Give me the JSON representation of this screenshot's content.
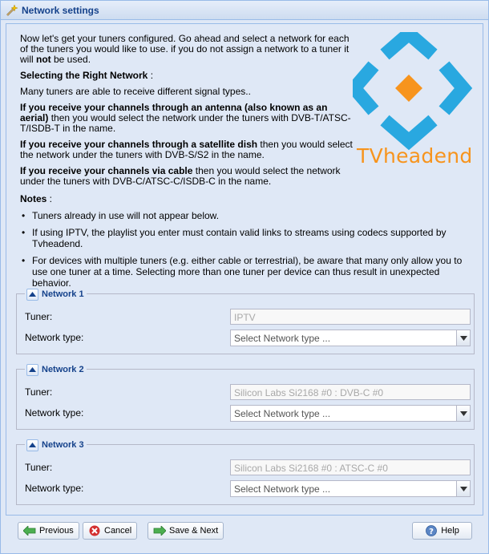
{
  "window": {
    "title": "Network settings"
  },
  "intro": {
    "p1_a": "Now let's get your tuners configured. Go ahead and select a network for each of the tuners you would like to use. if you do not assign a network to a tuner it will ",
    "p1_bold": "not",
    "p1_b": " be used.",
    "heading": "Selecting the Right Network",
    "heading_suffix": " :",
    "p2": "Many tuners are able to receive different signal types..",
    "antenna_bold": "If you receive your channels through an antenna (also known as an aerial)",
    "antenna_rest": " then you would select the network under the tuners with DVB-T/ATSC-T/ISDB-T in the name.",
    "satellite_bold": "If you receive your channels through a satellite dish",
    "satellite_rest": " then you would select the network under the tuners with DVB-S/S2 in the name.",
    "cable_bold": "If you receive your channels via cable",
    "cable_rest": " then you would select the network under the tuners with DVB-C/ATSC-C/ISDB-C in the name."
  },
  "logo": {
    "text": "TVheadend"
  },
  "notes": {
    "heading": "Notes",
    "heading_suffix": " :",
    "items": [
      "Tuners already in use will not appear below.",
      "If using IPTV, the playlist you enter must contain valid links to streams using codecs supported by Tvheadend.",
      "For devices with multiple tuners (e.g. either cable or terrestrial), be aware that many only allow you to use one tuner at a time. Selecting more than one tuner per device can thus result in unexpected behavior."
    ]
  },
  "networks": [
    {
      "legend": "Network 1",
      "tuner_label": "Tuner:",
      "tuner_value": "IPTV",
      "type_label": "Network type:",
      "type_placeholder": "Select Network type ..."
    },
    {
      "legend": "Network 2",
      "tuner_label": "Tuner:",
      "tuner_value": "Silicon Labs Si2168 #0 : DVB-C #0",
      "type_label": "Network type:",
      "type_placeholder": "Select Network type ..."
    },
    {
      "legend": "Network 3",
      "tuner_label": "Tuner:",
      "tuner_value": "Silicon Labs Si2168 #0 : ATSC-C #0",
      "type_label": "Network type:",
      "type_placeholder": "Select Network type ..."
    }
  ],
  "buttons": {
    "previous": "Previous",
    "cancel": "Cancel",
    "save_next": "Save & Next",
    "help": "Help"
  },
  "colors": {
    "accent": "#15428b",
    "logo_blue": "#29a8e0",
    "logo_orange": "#f7941d"
  }
}
